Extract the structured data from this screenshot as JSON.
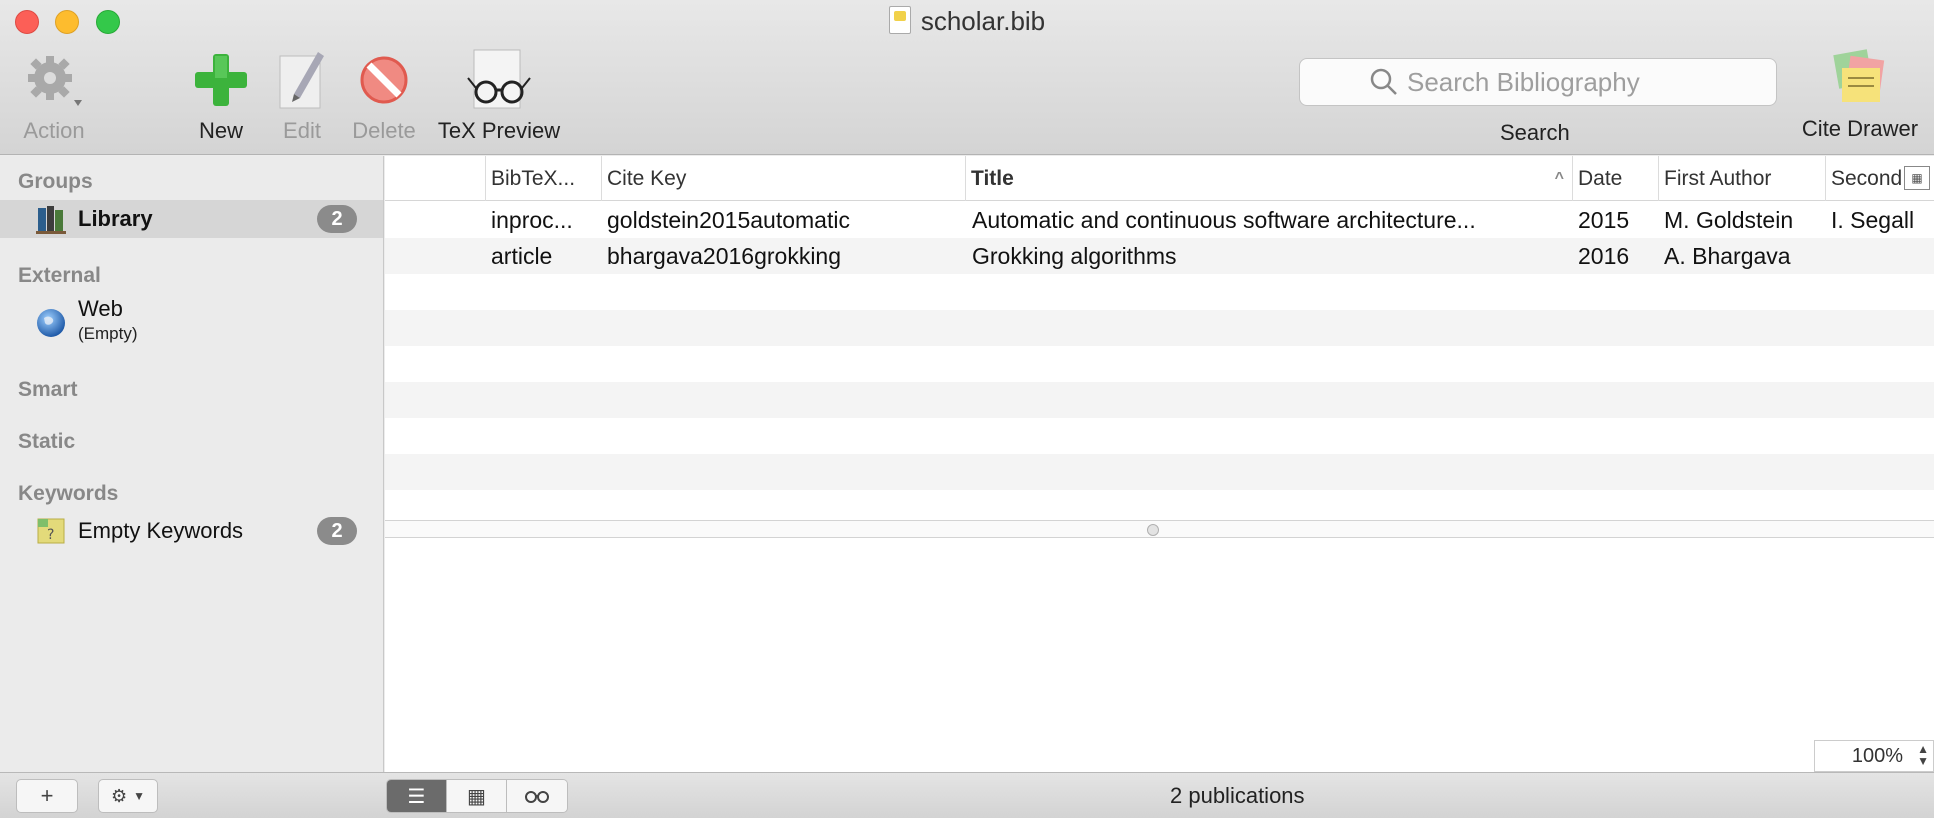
{
  "window": {
    "title": "scholar.bib"
  },
  "toolbar": {
    "action_label": "Action",
    "new_label": "New",
    "edit_label": "Edit",
    "delete_label": "Delete",
    "tex_preview_label": "TeX Preview",
    "search_placeholder": "Search Bibliography",
    "search_label": "Search",
    "cite_drawer_label": "Cite Drawer"
  },
  "sidebar": {
    "groups_header": "Groups",
    "library": {
      "label": "Library",
      "count": "2"
    },
    "external_header": "External",
    "web": {
      "label": "Web",
      "sub": "(Empty)"
    },
    "smart_header": "Smart",
    "static_header": "Static",
    "keywords_header": "Keywords",
    "empty_keywords": {
      "label": "Empty Keywords",
      "count": "2"
    }
  },
  "table": {
    "columns": [
      "BibTeX...",
      "Cite Key",
      "Title",
      "Date",
      "First Author",
      "Second"
    ],
    "sorted_column": "Title",
    "rows": [
      {
        "type": "inproc...",
        "cite_key": "goldstein2015automatic",
        "title": "Automatic and continuous software architecture...",
        "date": "2015",
        "first_author": "M. Goldstein",
        "second": "I. Segall"
      },
      {
        "type": "article",
        "cite_key": "bhargava2016grokking",
        "title": "Grokking algorithms",
        "date": "2016",
        "first_author": "A. Bhargava",
        "second": ""
      }
    ]
  },
  "zoom": "100%",
  "status": {
    "publications": "2 publications"
  },
  "icons": {
    "action": "gear-icon",
    "new": "plus-icon",
    "edit": "pencil-icon",
    "delete": "no-entry-icon",
    "tex_preview": "glasses-icon",
    "search": "magnifier-icon",
    "cite_drawer": "notes-icon",
    "library": "books-icon",
    "web": "globe-icon",
    "keywords": "keyword-note-icon"
  },
  "colors": {
    "new_green": "#3cb33c",
    "delete_red": "#e05a4f",
    "selection_gray": "#d6d6d6",
    "badge": "#8b8b8b"
  }
}
